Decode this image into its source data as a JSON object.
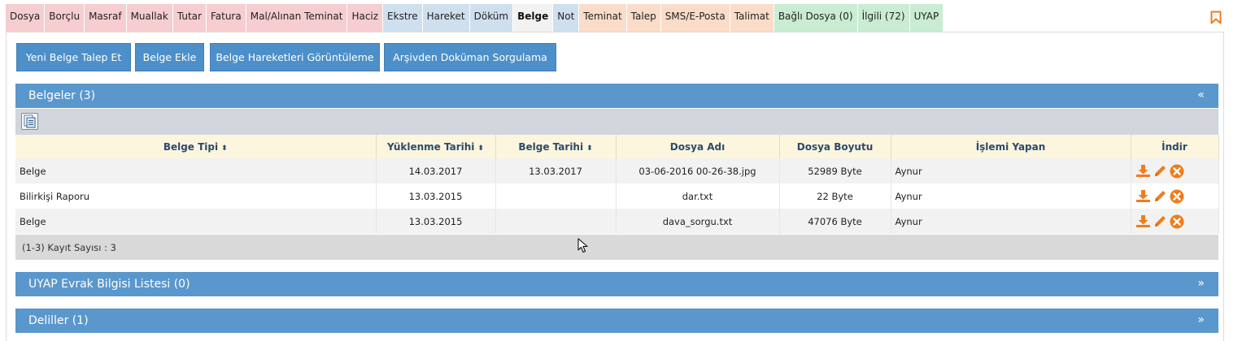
{
  "tabs": [
    {
      "label": "Dosya",
      "color": "pink"
    },
    {
      "label": "Borçlu",
      "color": "pink"
    },
    {
      "label": "Masraf",
      "color": "pink"
    },
    {
      "label": "Muallak",
      "color": "pink"
    },
    {
      "label": "Tutar",
      "color": "pink"
    },
    {
      "label": "Fatura",
      "color": "pink"
    },
    {
      "label": "Mal/Alınan Teminat",
      "color": "pink"
    },
    {
      "label": "Haciz",
      "color": "pink"
    },
    {
      "label": "Ekstre",
      "color": "blue"
    },
    {
      "label": "Hareket",
      "color": "blue"
    },
    {
      "label": "Döküm",
      "color": "blue"
    },
    {
      "label": "Belge",
      "color": "active"
    },
    {
      "label": "Not",
      "color": "blue"
    },
    {
      "label": "Teminat",
      "color": "peach"
    },
    {
      "label": "Talep",
      "color": "peach"
    },
    {
      "label": "SMS/E-Posta",
      "color": "peach"
    },
    {
      "label": "Talimat",
      "color": "peach"
    },
    {
      "label": "Bağlı Dosya (0)",
      "color": "green"
    },
    {
      "label": "İlgili (72)",
      "color": "green"
    },
    {
      "label": "UYAP",
      "color": "green"
    }
  ],
  "icons": {
    "bookmark": "bookmark-icon",
    "export": "export-icon",
    "download": "download-icon",
    "edit": "pencil-icon",
    "delete": "delete-icon"
  },
  "colors": {
    "accent": "#5a97cd",
    "button": "#4d8fc9",
    "action_orange": "#f07c1b"
  },
  "actions": {
    "request_document": "Yeni Belge Talep Et",
    "add_document": "Belge Ekle",
    "document_movements": "Belge Hareketleri Görüntüleme",
    "archive_query": "Arşivden Doküman Sorgulama"
  },
  "panels": {
    "documents": {
      "title": "Belgeler (3)",
      "toggle": "«"
    },
    "uyap": {
      "title": "UYAP Evrak Bilgisi Listesi (0)",
      "toggle": "»"
    },
    "evidence": {
      "title": "Deliller (1)",
      "toggle": "»"
    }
  },
  "table": {
    "columns": [
      "Belge Tipi",
      "Yüklenme Tarihi",
      "Belge Tarihi",
      "Dosya Adı",
      "Dosya Boyutu",
      "İşlemi Yapan",
      "İndir"
    ],
    "sort_indicator": "⬍",
    "rows": [
      {
        "type": "Belge",
        "uploaded": "14.03.2017",
        "doc_date": "13.03.2017",
        "file": "03-06-2016 00-26-38.jpg",
        "size": "52989 Byte",
        "user": "Aynur"
      },
      {
        "type": "Bilirkişi Raporu",
        "uploaded": "13.03.2015",
        "doc_date": "",
        "file": "dar.txt",
        "size": "22 Byte",
        "user": "Aynur"
      },
      {
        "type": "Belge",
        "uploaded": "13.03.2015",
        "doc_date": "",
        "file": "dava_sorgu.txt",
        "size": "47076 Byte",
        "user": "Aynur"
      }
    ],
    "footer": "(1-3) Kayıt Sayısı : 3"
  }
}
